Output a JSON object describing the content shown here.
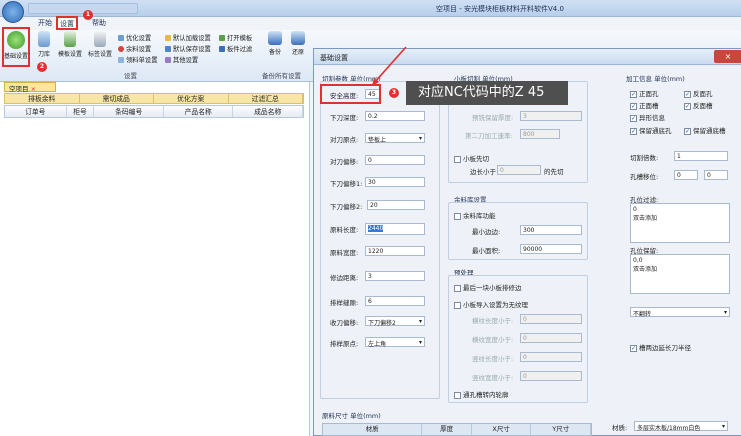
{
  "app": {
    "title": "空项目 - 安光模块柜板材料开料软件V4.0"
  },
  "menu": {
    "start": "开始",
    "settings": "设置",
    "help": "帮助"
  },
  "badges": {
    "one": "1",
    "two": "2",
    "three": "3"
  },
  "ribbon": {
    "basic_settings": "基础设置",
    "tool_library": "刀库",
    "template_settings": "模板设置",
    "label_settings": "标签设置",
    "optimize_settings": "优化设置",
    "remnant_settings": "余料设置",
    "material_sheet_settings": "领料单设置",
    "default_load_settings": "默认加载设置",
    "default_save_settings": "默认保存设置",
    "other_settings": "其他设置",
    "open_template": "打开模板",
    "panel_filter": "板件过滤",
    "backup": "备份",
    "restore": "还原",
    "group_settings": "设置",
    "group_backup": "备份所有设置"
  },
  "left": {
    "doc_tab": "空项目",
    "subtabs": [
      "排板余料",
      "需切成品",
      "优化方案",
      "过滤汇总"
    ],
    "columns": [
      "订单号",
      "柜号",
      "条码编号",
      "产品名称",
      "成品名称"
    ]
  },
  "dialog": {
    "title": "基础设置",
    "close_icon": "×",
    "cut_params": {
      "title": "切割参数 单位(mm)",
      "safety_height_label": "安全高度:",
      "safety_height": "45",
      "cut_depth_label": "下刀深度:",
      "cut_depth": "0.2",
      "tool_origin_label": "对刀原点:",
      "tool_origin": "垫板上",
      "tool_offset_label": "对刀偏移:",
      "tool_offset": "0",
      "down_offset_label": "下刀偏移1:",
      "down_offset": "30",
      "down_offset2_label": "下刀偏移2:",
      "down_offset2": "20",
      "sheet_length_label": "原料长度:",
      "sheet_length": "2440",
      "sheet_width_label": "原料宽度:",
      "sheet_width": "1220",
      "trim_label": "修边距离:",
      "trim": "3",
      "gap_label": "排样缝隙:",
      "gap": "6",
      "retract_label": "收刀偏移:",
      "retract": "下刀偏移2",
      "layout_origin_label": "排样原点:",
      "layout_origin": "左上角"
    },
    "small_cut": {
      "title": "小板切割 单位(mm)",
      "field1_label": "预铣保留厚度:",
      "field1": "3",
      "field2_label": "第二刀加工速率:",
      "field2": "800",
      "first_cut_label": "小板先切",
      "edge_less_label": "边长小于",
      "edge_less": "0",
      "first_cut_suffix": "的先切"
    },
    "remnant": {
      "title": "余料库设置",
      "enable_label": "余料库功能",
      "min_edge_label": "最小边边:",
      "min_edge": "300",
      "min_area_label": "最小面积:",
      "min_area": "90000"
    },
    "preprocess": {
      "title": "预处理",
      "last_small_label": "最后一块小板排修边",
      "small_import_label": "小板导入设置为无纹理",
      "h1_label": "横纹长度小于:",
      "h1": "0",
      "h2_label": "横纹宽度小于:",
      "h2": "0",
      "v1_label": "竖纹长度小于:",
      "v1": "0",
      "v2_label": "竖纹宽度小于:",
      "v2": "0",
      "slot_contour_label": "通孔槽转内轮廓"
    },
    "process_info": {
      "title": "加工信息 单位(mm)",
      "front_hole": "正面孔",
      "back_hole": "反面孔",
      "front_slot": "正面槽",
      "back_slot": "反面槽",
      "special_info": "异形信息",
      "keep_through_hole": "保留通底孔",
      "keep_through_slot": "保留通底槽",
      "cut_times_label": "切割倍数:",
      "cut_times": "1",
      "hole_offset_label": "孔槽移位:",
      "hole_offset_x": "0",
      "hole_offset_y": "0",
      "hole_filter_label": "孔位过滤:",
      "hole_filter_value": "0",
      "hole_filter_hint": "双击添加",
      "hole_keep_label": "孔位保留:",
      "hole_keep_value": "0,0",
      "hole_keep_hint": "双击添加",
      "flip_select": "不翻转",
      "slot_extend_label": "槽两边延长刀半径"
    },
    "material_table": {
      "title": "原料尺寸 单位(mm)",
      "columns": [
        "材质",
        "厚度",
        "X尺寸",
        "Y尺寸"
      ],
      "material_label": "材质:",
      "material_value": "多层实木板/18mm白色"
    }
  },
  "annotation": "对应NC代码中的Z 45",
  "colors": {
    "accent_red": "#e03030",
    "title_blue": "#c9dbf0",
    "tab_yellow": "#f8e6a6"
  }
}
